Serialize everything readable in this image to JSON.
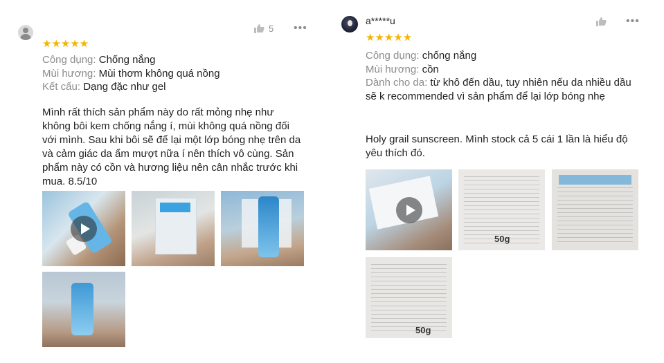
{
  "reviews": [
    {
      "username": "",
      "stars": "★★★★★",
      "rating": 5,
      "likes": "5",
      "more": "•••",
      "attributes": [
        {
          "key": "Công dụng:",
          "value": "Chống nắng"
        },
        {
          "key": "Mùi hương:",
          "value": "Mùi thơm không quá nồng"
        },
        {
          "key": "Kết cấu:",
          "value": "Dạng đặc như gel"
        }
      ],
      "comment": "Mình rất thích sản phẩm này do rất mỏng nhẹ như không bôi kem chống nắng í, mùi không quá nồng đối với mình. Sau khi bôi sẽ để lại một lớp bóng nhẹ trên da và cảm giác da ẩm mượt nữa í nên thích vô cùng. Sản phẩm này có cồn và hương liệu nên cân nhắc trước khi mua. 8.5/10"
    },
    {
      "username": "a*****u",
      "stars": "★★★★★",
      "rating": 5,
      "likes": "",
      "more": "•••",
      "attributes": [
        {
          "key": "Công dụng:",
          "value": "chống nắng"
        },
        {
          "key": "Mùi hương:",
          "value": "cồn"
        },
        {
          "key": "Dành cho da:",
          "value": "từ khô đến dầu, tuy nhiên nếu da nhiều dầu sẽ k recommended vì sản phẩm để lại lớp bóng nhẹ"
        }
      ],
      "comment": "Holy grail sunscreen. Mình stock cả 5 cái 1 lần là hiểu độ yêu thích đó.",
      "media_labels": {
        "r2": "50g",
        "r4": "50g"
      }
    }
  ],
  "colors": {
    "star": "#f5b400",
    "label_gray": "#8c8c8c",
    "text": "#222222"
  },
  "icons": {
    "like": "thumbs-up-icon",
    "more": "more-dots-icon",
    "play": "play-icon",
    "avatar": "avatar-icon"
  }
}
